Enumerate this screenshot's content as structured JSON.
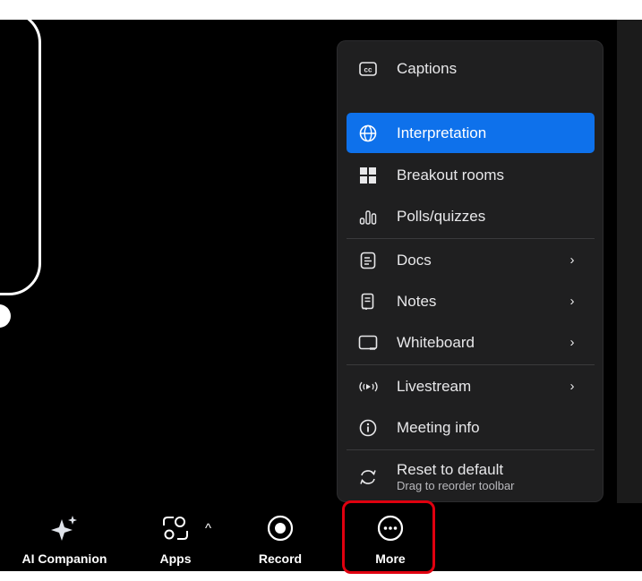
{
  "menu": {
    "items": [
      {
        "label": "Captions",
        "icon": "captions-icon"
      },
      {
        "label": "Interpretation",
        "icon": "globe-icon",
        "active": true
      },
      {
        "label": "Breakout rooms",
        "icon": "breakout-rooms-icon"
      },
      {
        "label": "Polls/quizzes",
        "icon": "polls-icon"
      },
      {
        "label": "Docs",
        "icon": "docs-icon",
        "submenu": true
      },
      {
        "label": "Notes",
        "icon": "notes-icon",
        "submenu": true
      },
      {
        "label": "Whiteboard",
        "icon": "whiteboard-icon",
        "submenu": true
      },
      {
        "label": "Livestream",
        "icon": "livestream-icon",
        "submenu": true
      },
      {
        "label": "Meeting info",
        "icon": "info-icon"
      }
    ],
    "reset": {
      "label": "Reset to default",
      "sublabel": "Drag to reorder toolbar",
      "icon": "reset-icon"
    },
    "chevron": "›"
  },
  "toolbar": {
    "ai_companion": "AI Companion",
    "apps": "Apps",
    "apps_caret": "^",
    "record": "Record",
    "more": "More"
  },
  "colors": {
    "accent": "#0e71eb",
    "highlight": "#e0000f",
    "menu_bg": "#1f1f20"
  }
}
